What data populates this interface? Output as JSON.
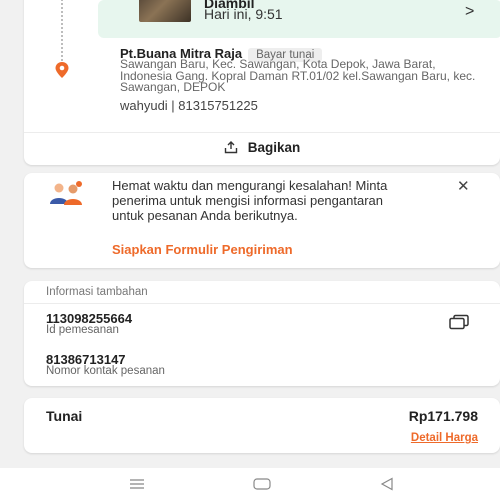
{
  "tracking": {
    "status_title": "Diambil",
    "status_time": "Hari ini, 9:51",
    "recipient_name": "Pt.Buana Mitra Raja",
    "payment_badge": "Bayar tunai",
    "address": "Sawangan Baru, Kec. Sawangan, Kota Depok, Jawa Barat, Indonesia Gang. Kopral Daman RT.01/02 kel.Sawangan Baru, kec. Sawangan, DEPOK",
    "contact": "wahyudi | 81315751225",
    "share_label": "Bagikan",
    "icons": {
      "status": "chevron-right-icon",
      "location": "location-pin-icon",
      "share": "share-icon"
    }
  },
  "tip": {
    "message": "Hemat waktu dan mengurangi kesalahan! Minta penerima untuk mengisi informasi pengantaran untuk pesanan Anda berikutnya.",
    "link_label": "Siapkan Formulir Pengiriman",
    "accent_color": "#ee6a2a"
  },
  "info": {
    "heading": "Informasi tambahan",
    "order_id": "113098255664",
    "order_id_label": "Id pemesanan",
    "contact_number": "81386713147",
    "contact_number_label": "Nomor kontak pesanan"
  },
  "payment": {
    "method": "Tunai",
    "amount": "Rp171.798",
    "detail_link": "Detail Harga"
  },
  "navbar": {
    "icons": [
      "menu-icon",
      "home-icon",
      "back-icon"
    ]
  }
}
